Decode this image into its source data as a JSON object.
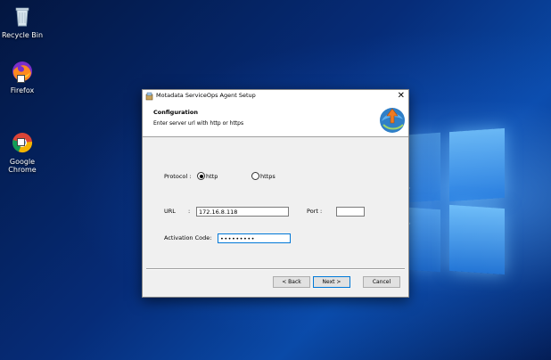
{
  "desktop": {
    "icons": [
      {
        "name": "recycle-bin",
        "label": "Recycle Bin"
      },
      {
        "name": "firefox",
        "label": "Firefox"
      },
      {
        "name": "chrome",
        "label": "Google\nChrome"
      }
    ]
  },
  "dialog": {
    "title": "Motadata ServiceOps Agent Setup",
    "close_glyph": "✕",
    "heading": "Configuration",
    "subheading": "Enter server url with http or https",
    "protocol_label": "Protocol :",
    "options": [
      {
        "label": "http",
        "selected": true
      },
      {
        "label": "https",
        "selected": false
      }
    ],
    "url_label": "URL",
    "url_colon": ":",
    "url_value": "172.16.8.118",
    "port_label": "Port :",
    "port_value": "",
    "activation_label": "Activation Code:",
    "activation_value": "•••••••••",
    "buttons": {
      "back": "< Back",
      "next": "Next >",
      "cancel": "Cancel"
    }
  },
  "colors": {
    "accent": "#0078d7",
    "dialog_bg": "#f0f0f0"
  }
}
